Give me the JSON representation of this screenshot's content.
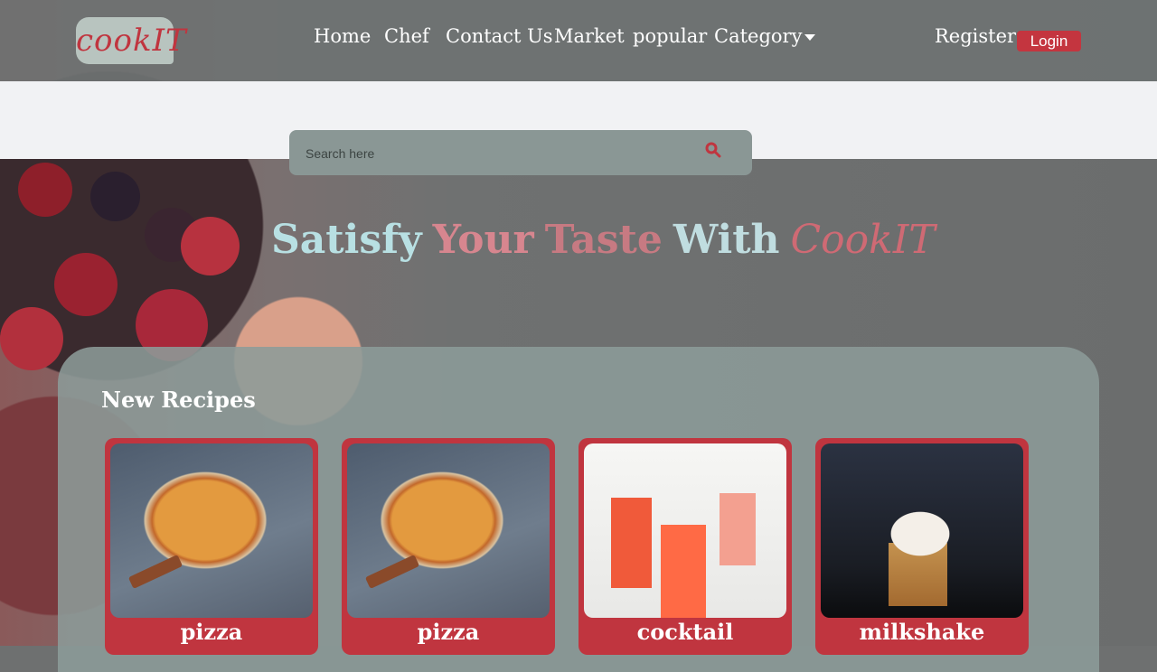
{
  "brand": {
    "logo_text": "cookIT"
  },
  "nav": {
    "items": [
      {
        "label": "Home"
      },
      {
        "label": "Chef"
      },
      {
        "label": "Contact Us"
      },
      {
        "label": "Market"
      },
      {
        "label": "popular"
      },
      {
        "label": "Category"
      }
    ],
    "register_label": "Register",
    "login_label": "Login"
  },
  "search": {
    "placeholder": "Search here"
  },
  "hero": {
    "words": [
      "Satisfy",
      "Your",
      "Taste",
      "With",
      "CookIT"
    ]
  },
  "recipes": {
    "title": "New Recipes",
    "cards": [
      {
        "name": "pizza",
        "image": "pizza-photo"
      },
      {
        "name": "pizza",
        "image": "pizza-photo"
      },
      {
        "name": "cocktail",
        "image": "cocktail-photo"
      },
      {
        "name": "milkshake",
        "image": "milkshake-photo"
      }
    ]
  },
  "colors": {
    "accent": "#c0353f",
    "header_bg": "#6e7272",
    "band_bg": "#f1f2f4",
    "panel_bg": "#8c9b99"
  }
}
